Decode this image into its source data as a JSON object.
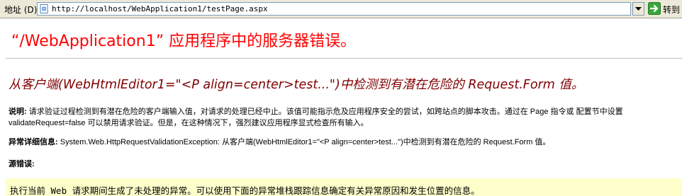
{
  "browser": {
    "address_label": "地址 (D)",
    "url": "http://localhost/WebApplication1/testPage.aspx",
    "go_label": "转到"
  },
  "page": {
    "title": "“/WebApplication1” 应用程序中的服务器错误。",
    "subtitle": "从客户端(WebHtmlEditor1=\"<P align=center>test...\")中检测到有潜在危险的 Request.Form 值。",
    "description_label": "说明:",
    "description_text": "请求验证过程检测到有潜在危险的客户端输入值，对请求的处理已经中止。该值可能指示危及应用程序安全的尝试，如跨站点的脚本攻击。通过在 Page 指令或 配置节中设置 validateRequest=false 可以禁用请求验证。但是，在这种情况下，强烈建议应用程序显式检查所有输入。",
    "exception_label": "异常详细信息:",
    "exception_text": "System.Web.HttpRequestValidationException: 从客户端(WebHtmlEditor1=\"<P align=center>test...\")中检测到有潜在危险的 Request.Form 值。",
    "source_error_label": "源错误:",
    "source_error_text": "执行当前 Web 请求期间生成了未处理的异常。可以使用下面的异常堆栈跟踪信息确定有关异常原因和发生位置的信息。"
  },
  "colors": {
    "title": "#ff0000",
    "subtitle": "#800000",
    "error_box": "#ffffcc"
  }
}
